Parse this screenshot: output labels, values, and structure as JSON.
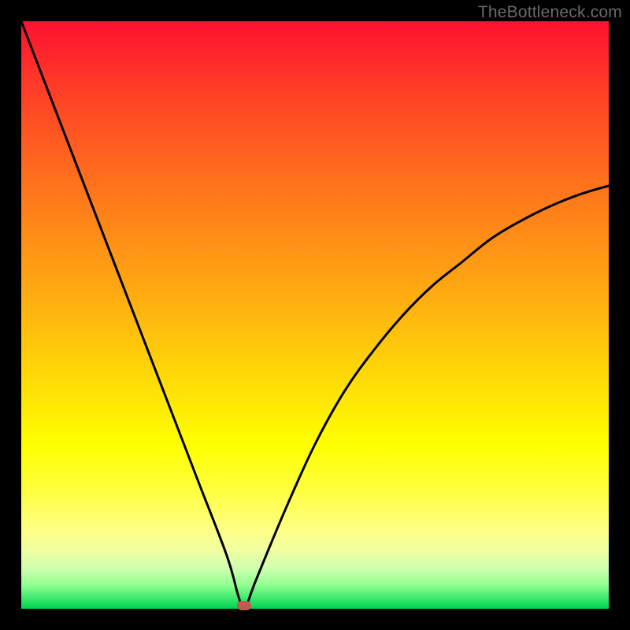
{
  "watermark": "TheBottleneck.com",
  "colors": {
    "frame": "#000000",
    "curve": "#000000",
    "marker": "#c05a50",
    "gradient_top": "#ff1030",
    "gradient_bottom": "#00d050"
  },
  "chart_data": {
    "type": "line",
    "title": "",
    "xlabel": "",
    "ylabel": "",
    "xlim": [
      0,
      100
    ],
    "ylim": [
      0,
      100
    ],
    "curve_description": "V-shaped bottleneck curve: steep left branch from (0,100) down to minimum near x≈38, gentler right branch rising to ≈(100,72)",
    "series": [
      {
        "name": "left-branch",
        "x": [
          0,
          5,
          10,
          15,
          20,
          25,
          30,
          35,
          37,
          38
        ],
        "values": [
          100,
          87,
          74,
          61,
          48,
          35,
          22,
          9,
          2,
          0
        ]
      },
      {
        "name": "right-branch",
        "x": [
          38,
          40,
          45,
          50,
          55,
          60,
          65,
          70,
          75,
          80,
          85,
          90,
          95,
          100
        ],
        "values": [
          0,
          5,
          17,
          28,
          37,
          44,
          50,
          55,
          59,
          63,
          66,
          68.5,
          70.5,
          72
        ]
      }
    ],
    "marker": {
      "x": 38,
      "y": 0
    },
    "grid": false,
    "legend": false
  }
}
